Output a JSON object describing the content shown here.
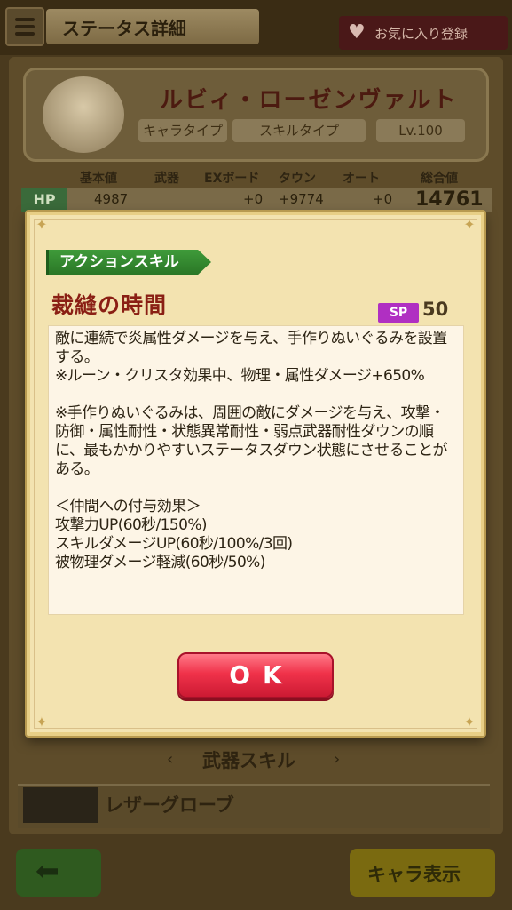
{
  "header": {
    "title": "ステータス詳細",
    "favorite_label": "お気に入り登録"
  },
  "character": {
    "name": "ルビィ・ローゼンヴァルト",
    "type_label": "キャラタイプ",
    "skill_type_label": "スキルタイプ",
    "level": "Lv.100"
  },
  "stats": {
    "headers": [
      "基本値",
      "武器",
      "EXボード",
      "タウン",
      "オート",
      "総合値"
    ],
    "hp": {
      "label": "HP",
      "base": "4987",
      "ex_board": "+0",
      "town": "+9774",
      "auto": "+0",
      "total": "14761"
    }
  },
  "dialog": {
    "category": "アクションスキル",
    "skill_name": "裁縫の時間",
    "sp_label": "SP",
    "sp_value": "50",
    "description": "敵に連続で炎属性ダメージを与え、手作りぬいぐるみを設置する。\n※ルーン・クリスタ効果中、物理・属性ダメージ+650%\n\n※手作りぬいぐるみは、周囲の敵にダメージを与え、攻撃・防御・属性耐性・状態異常耐性・弱点武器耐性ダウンの順に、最もかかりやすいステータスダウン状態にさせることがある。\n\n＜仲間への付与効果＞\n攻撃力UP(60秒/150%)\nスキルダメージUP(60秒/100%/3回)\n被物理ダメージ軽減(60秒/50%)",
    "ok_label": "OK"
  },
  "weapon_section": {
    "title": "武器スキル",
    "weapon_name": "レザーグローブ"
  },
  "footer": {
    "chara_view_label": "キャラ表示"
  },
  "colors": {
    "skill_name": "#8a1f14",
    "action_tag": "#2a7726",
    "sp_badge": "#b02fc2",
    "ok_button": "#f0324a"
  }
}
